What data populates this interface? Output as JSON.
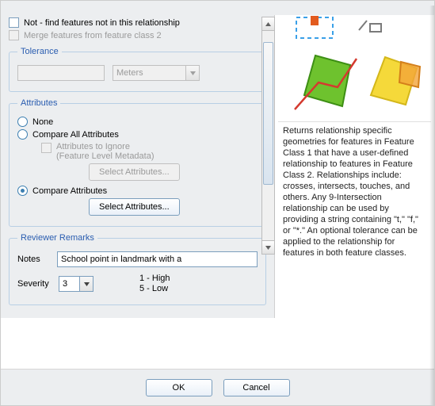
{
  "checkboxes": {
    "not_label": "Not - find features not in this relationship",
    "merge_label": "Merge features from feature class 2"
  },
  "tolerance": {
    "legend": "Tolerance",
    "value": "",
    "unit": "Meters"
  },
  "attributes": {
    "legend": "Attributes",
    "none": "None",
    "compare_all": "Compare All Attributes",
    "ignore_label1": "Attributes to Ignore",
    "ignore_label2": "(Feature Level Metadata)",
    "select_btn": "Select Attributes...",
    "compare": "Compare Attributes"
  },
  "reviewer": {
    "legend": "Reviewer Remarks",
    "notes_label": "Notes",
    "notes_value": "School point in landmark with a",
    "severity_label": "Severity",
    "severity_value": "3",
    "scale_high": "1 - High",
    "scale_low": "5 - Low"
  },
  "help": {
    "text": "Returns relationship specific geometries for features in Feature Class 1 that have a user-defined relationship to features in Feature Class 2.  Relationships include: crosses, intersects, touches, and others.  Any 9-Intersection relationship can be used by providing a string containing \"t,\" \"f,\" or \"*.\"  An optional tolerance can be applied to the relationship for features in both feature classes."
  },
  "buttons": {
    "ok": "OK",
    "cancel": "Cancel"
  }
}
